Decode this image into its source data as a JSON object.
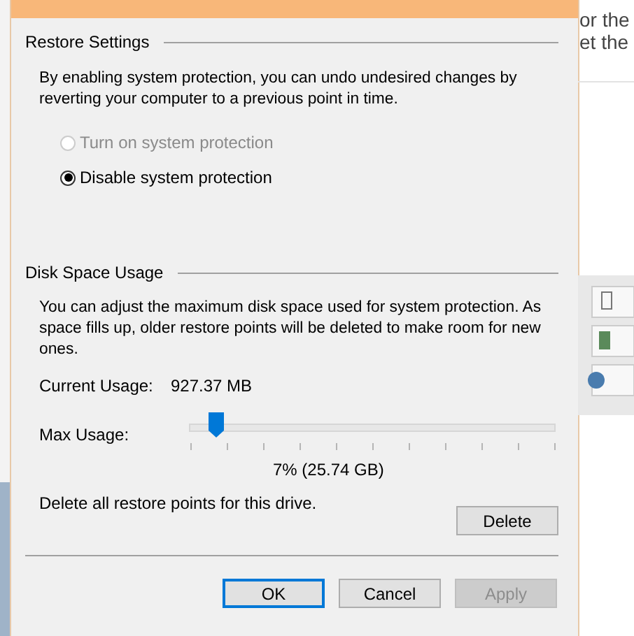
{
  "background": {
    "texts": [
      "or the",
      "et the"
    ]
  },
  "dialog": {
    "restore_settings": {
      "heading": "Restore Settings",
      "description": "By enabling system protection, you can undo undesired changes by reverting your computer to a previous point in time.",
      "options": [
        {
          "label": "Turn on system protection",
          "selected": false,
          "disabled": true
        },
        {
          "label": "Disable system protection",
          "selected": true,
          "disabled": false
        }
      ]
    },
    "disk_space_usage": {
      "heading": "Disk Space Usage",
      "description": "You can adjust the maximum disk space used for system protection. As space fills up, older restore points will be deleted to make room for new ones.",
      "current_usage": {
        "label": "Current Usage:",
        "value": "927.37 MB"
      },
      "max_usage": {
        "label": "Max Usage:",
        "level": 0.07,
        "reading": "7% (25.74 GB)"
      },
      "delete_note": "Delete all restore points for this drive.",
      "delete_button": "Delete"
    },
    "buttons": [
      {
        "label": "OK",
        "kind": "default",
        "disabled": false
      },
      {
        "label": "Cancel",
        "kind": "normal",
        "disabled": false
      },
      {
        "label": "Apply",
        "kind": "normal",
        "disabled": true
      }
    ]
  }
}
